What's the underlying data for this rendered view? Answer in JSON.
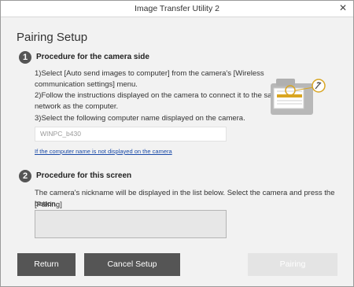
{
  "window": {
    "title": "Image Transfer Utility 2",
    "close_glyph": "✕"
  },
  "page": {
    "title": "Pairing Setup"
  },
  "step1": {
    "number": "1",
    "heading": "Procedure for the camera side",
    "line1a": "1)Select [Auto send images to computer] from the camera's [Wireless",
    "line1b": "communication settings] menu.",
    "line2a": "2)Follow the instructions displayed on the camera to connect it to the same",
    "line2b": "network as the computer.",
    "line3": "3)Select the following computer name displayed on the camera.",
    "computer_name": "WINPC_b430",
    "link": "If the computer name is not displayed on the camera"
  },
  "step2": {
    "number": "2",
    "heading": "Procedure for this screen",
    "desc_a": "The camera's nickname will be displayed in the list below. Select the camera and press the [Pairing]",
    "desc_b": "button."
  },
  "buttons": {
    "return": "Return",
    "cancel": "Cancel Setup",
    "pairing": "Pairing"
  },
  "illustration": {
    "icon": "camera-wireless-icon",
    "accent_color": "#d9a521"
  }
}
